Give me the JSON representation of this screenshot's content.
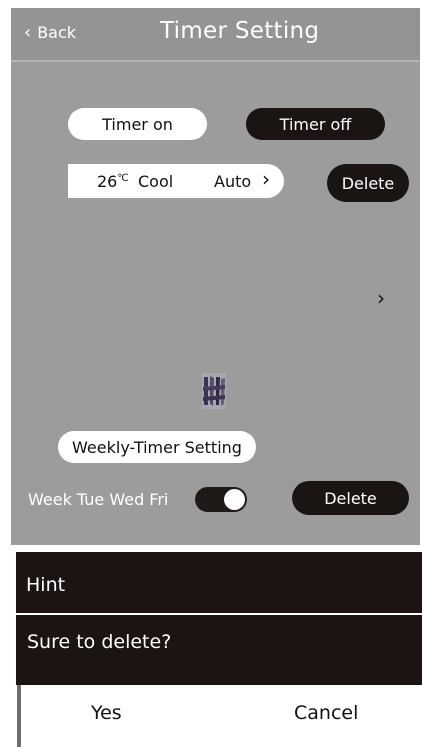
{
  "header": {
    "back_label": "Back",
    "title": "Timer Setting"
  },
  "tabs": {
    "timer_on": "Timer on",
    "timer_off": "Timer off"
  },
  "setting": {
    "temperature": "26",
    "unit": "℃",
    "mode": "Cool",
    "fan": "Auto"
  },
  "buttons": {
    "delete_top": "Delete",
    "weekly": "Weekly-Timer Setting",
    "delete_bottom": "Delete"
  },
  "week": {
    "days": "Week Tue Wed Fri",
    "toggle_on": true
  },
  "dialog": {
    "title": "Hint",
    "message": "Sure to delete?",
    "yes": "Yes",
    "cancel": "Cancel"
  },
  "colors": {
    "panel": "#9c9c9c",
    "dark": "#1c1413",
    "light": "#ffffff"
  }
}
